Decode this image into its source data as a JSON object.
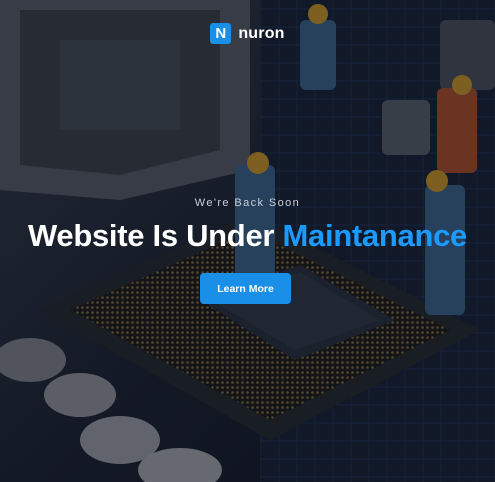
{
  "brand": {
    "mark": "N",
    "name": "nuron",
    "accent_color": "#1a8fe8"
  },
  "hero": {
    "tagline": "We're Back Soon",
    "headline_main": "Website Is Under",
    "headline_accent": "Maintanance",
    "cta_label": "Learn More"
  },
  "background": {
    "subject": "motherboard-cpu-socket-with-miniature-workers-photo"
  }
}
